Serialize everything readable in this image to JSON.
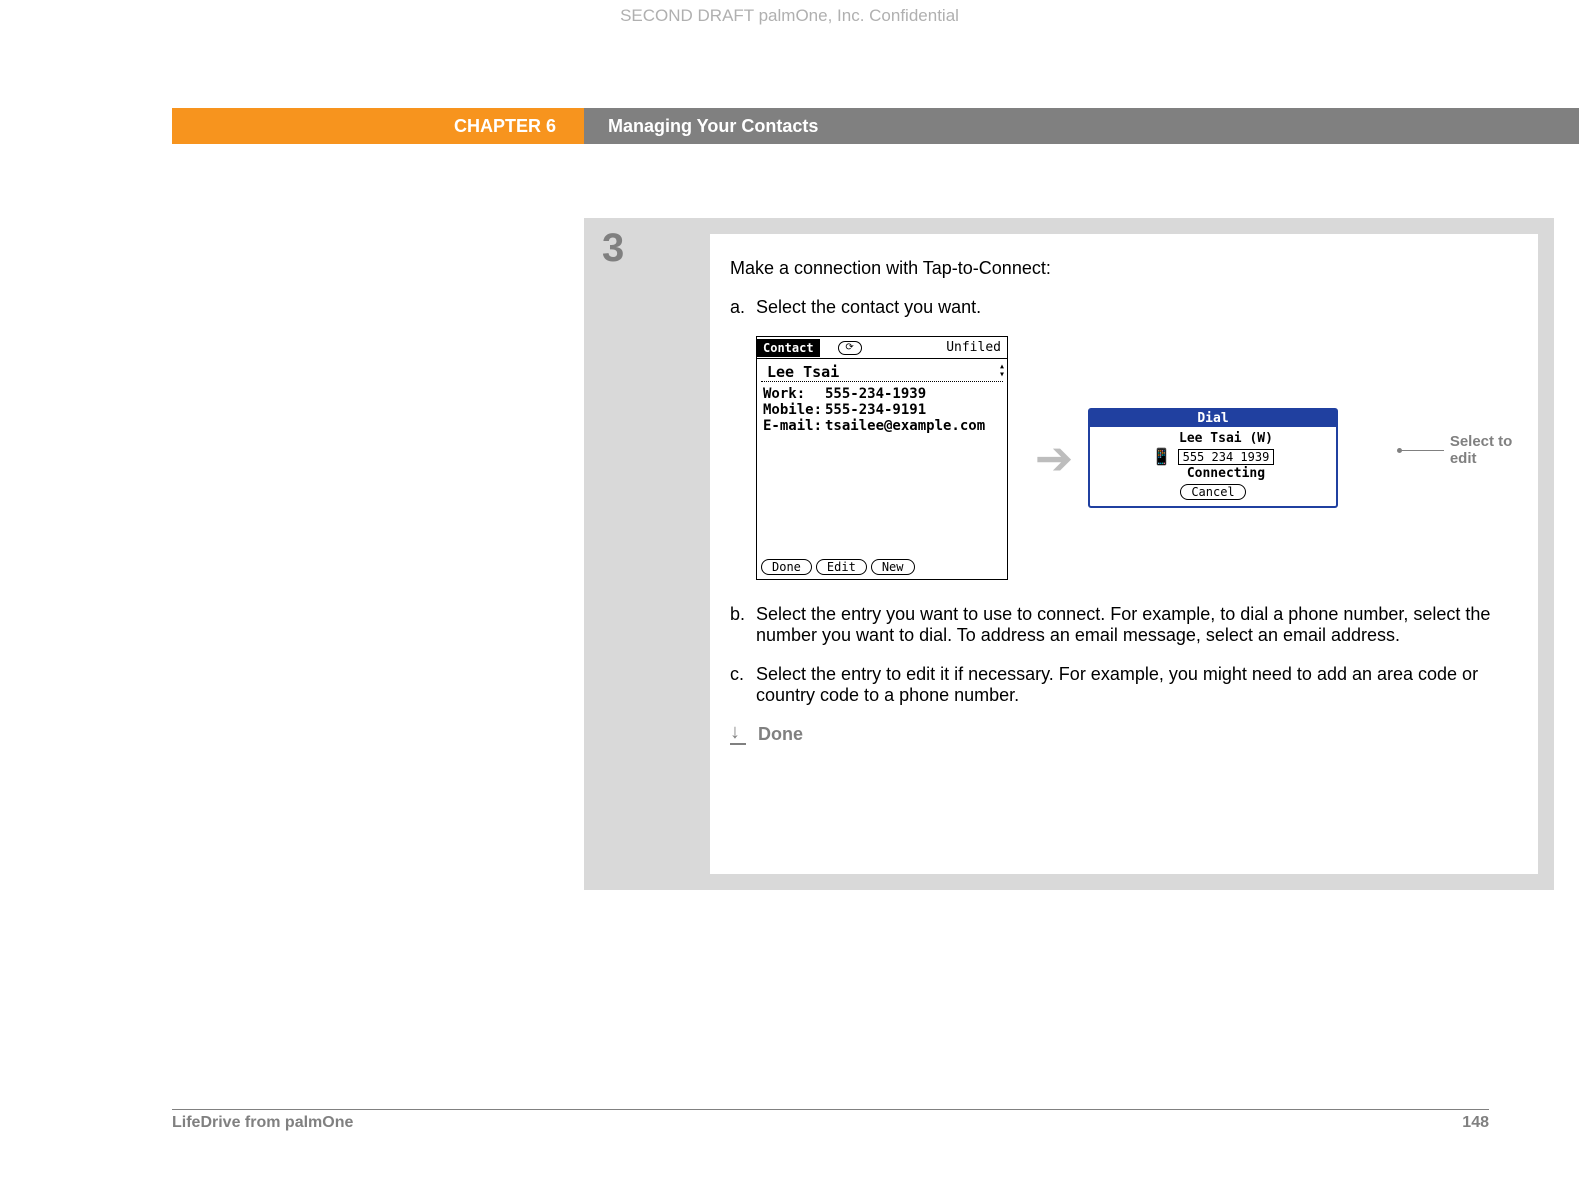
{
  "watermark": "SECOND DRAFT palmOne, Inc.  Confidential",
  "header": {
    "chapter": "CHAPTER 6",
    "title": "Managing Your Contacts"
  },
  "step": {
    "number": "3",
    "intro": "Make a connection with Tap-to-Connect:",
    "a_label": "a.",
    "a_text": "Select the contact you want.",
    "b_label": "b.",
    "b_text": "Select the entry you want to use to connect. For example, to dial a phone number, select the number you want to dial. To address an email message, select an email address.",
    "c_label": "c.",
    "c_text": "Select the entry to edit it if necessary. For example, you might need to add an area code or country code to a phone number.",
    "done": "Done"
  },
  "contact_card": {
    "title": "Contact",
    "category": "Unfiled",
    "name": "Lee Tsai",
    "fields": [
      {
        "label": "Work:",
        "value": "555-234-1939"
      },
      {
        "label": "Mobile:",
        "value": "555-234-9191"
      },
      {
        "label": "E-mail:",
        "value": "tsailee@example.com"
      }
    ],
    "buttons": {
      "done": "Done",
      "edit": "Edit",
      "new": "New"
    }
  },
  "dial_card": {
    "title": "Dial",
    "name": "Lee Tsai (W)",
    "number": "555 234 1939",
    "status": "Connecting",
    "cancel": "Cancel"
  },
  "callout": "Select to edit",
  "footer": {
    "product": "LifeDrive from palmOne",
    "page": "148"
  }
}
